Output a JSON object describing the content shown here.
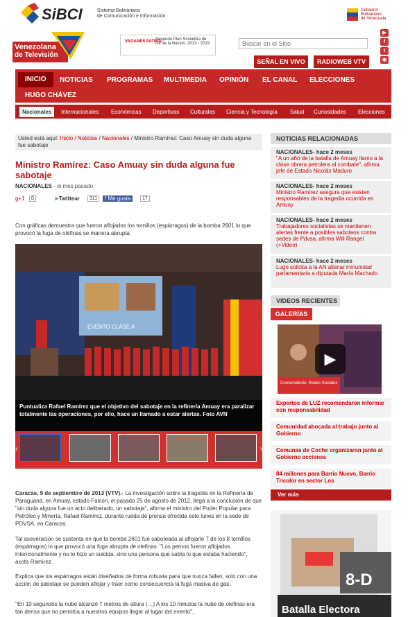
{
  "site": {
    "sibci_name": "SiBCI",
    "sibci_sub1": "Sistema Bolivariano",
    "sibci_sub2": "de Comunicación e Información",
    "gov_line1": "Gobierno",
    "gov_line2": "Bolivariano",
    "gov_line3": "de Venezuela",
    "vtv_line1": "Venezolana",
    "vtv_line2": "de Televisión",
    "banner_left": "VAGANES PATRIA",
    "banner_right": "Segundo Plan Socialista de De de la Nación. 2013 - 2019",
    "search_placeholder": "Buscar en el Sitio",
    "senal_label": "SEÑAL EN VIVO",
    "radioweb_label": "RADIOWEB VTV"
  },
  "mainnav": [
    {
      "label": "INICIO"
    },
    {
      "label": "NOTICIAS"
    },
    {
      "label": "PROGRAMAS"
    },
    {
      "label": "MULTIMEDIA"
    },
    {
      "label": "OPINIÓN"
    },
    {
      "label": "EL CANAL"
    },
    {
      "label": "ELECCIONES"
    },
    {
      "label": "HUGO CHÁVEZ"
    }
  ],
  "subnav": [
    {
      "label": "Nacionales"
    },
    {
      "label": "Internacionales"
    },
    {
      "label": "Económicas"
    },
    {
      "label": "Deportivas"
    },
    {
      "label": "Culturales"
    },
    {
      "label": "Ciencia y Tecnología"
    },
    {
      "label": "Salud"
    },
    {
      "label": "Curiosidades"
    },
    {
      "label": "Elecciones"
    }
  ],
  "breadcrumb": {
    "prefix": "Usted está aquí: ",
    "inicio": "Inicio",
    "noticias": "Noticias",
    "nacionales": "Nacionales",
    "current": "Ministro Ramírez: Caso Amuay sin duda alguna fue sabotaje",
    "sep": " / "
  },
  "article": {
    "title": "Ministro Ramírez: Caso Amuay sin duda alguna fue sabotaje",
    "section": "NACIONALES",
    "time": " - el mes pasado",
    "gplus": "+1",
    "gplus_count": "0",
    "tweet": "Twittear",
    "tweet_count": "311",
    "like": "Me gusta",
    "like_count": "17",
    "lead": "Con gráficas demuestra que fueron aflojados los tornillos (espárragos) de la bomba 2601 lo que provocó la fuga de olefinas se manera abrupta",
    "photo_sign": "EVENTO CLASE A",
    "caption": "Puntualiza Rafael Ramírez que el objetivo del sabotaje en la refinería Amuay era paralizar totalmente las operaciones, por ello, hace un llamado a estar alertas. Foto AVN",
    "p1_bold": "Caracas, 9 de septiembre de 2013 (VTV).-",
    "p1": " La investigación sobre la tragedia en la Refinería de Paraguaná, en Amuay, estado Falcón, el pasado 25 de agosto de 2012, llega a la conclusión de que \"sin duda alguna fue un acto deliberado, un sabotaje\", afirma el ministro del Poder Popular para Petróleo y Minería, Rafael Ramírez, durante rueda de prensa ofrecida este lunes en la sede de PDVSA, en Caracas.",
    "p2": "Tal aseveración se sustenta en que la bomba 2601 fue saboteada al aflojarle 7 de los 8 tornillos (espárragos) lo que provocó una fuga abrupta de olefinas. \"Los pernos fueron aflojados intencionalmente y no lo hizo un suicida, sino una persona que sabía lo que estaba haciendo\", acota Ramírez.",
    "p3": "Explica que los espárragos están diseñados de forma robusta para que nunca fallen, solo con una acción de sabotaje se pueden aflojar y traer como consecuencia la fuga masiva de gas.",
    "p4": "\"En 10 segundos la nube alcanzó 7 metros de altura (…) A los 10 minutos la nube de olefinas era tan densa que no permitía a nuestros equipos llegar al lugar del evento\","
  },
  "sidebar": {
    "related_title": "NOTICIAS RELACIONADAS",
    "related": [
      {
        "head": "NACIONALES- hace 2 meses",
        "text": "\"A un año de la batalla de Amuay llamo a la clase obrera petrolera al combate\", afirma jefe de Estado Nicolás Maduro"
      },
      {
        "head": "NACIONALES- hace 2 meses",
        "text": "Ministro Ramírez asegura que existen responsables de la tragedia ocurrida en Amuay"
      },
      {
        "head": "NACIONALES- hace 2 meses",
        "text": "Trabajadores socialistas se mantienen alertas frente a posibles saboteos contra sedes de Pdvsa, afirma Will Rangel (+Video)"
      },
      {
        "head": "NACIONALES- hace 2 meses",
        "text": "Lugo solicita a la AN allanar inmunidad parlamentaria a diputada María Machado"
      }
    ],
    "videos_title": "VIDEOS RECIENTES",
    "galerias": "GALERÍAS",
    "video_caption": "Conversatorio: Redes Sociales",
    "videos": [
      {
        "text": "Expertos de LUZ recomendaron informar con responsabilidad"
      },
      {
        "text": "Comunidad abocada al trabajo junto al Gobierno"
      },
      {
        "text": "Comunas de Coche organizaron junto al Gobierno acciones"
      },
      {
        "text": "84 millones para Barrio Nuevo, Barrio Tricolor en sector Los"
      }
    ],
    "ver_mas": "Ver más",
    "ad_big": "8-D",
    "ad_text": "Batalla Electora"
  }
}
